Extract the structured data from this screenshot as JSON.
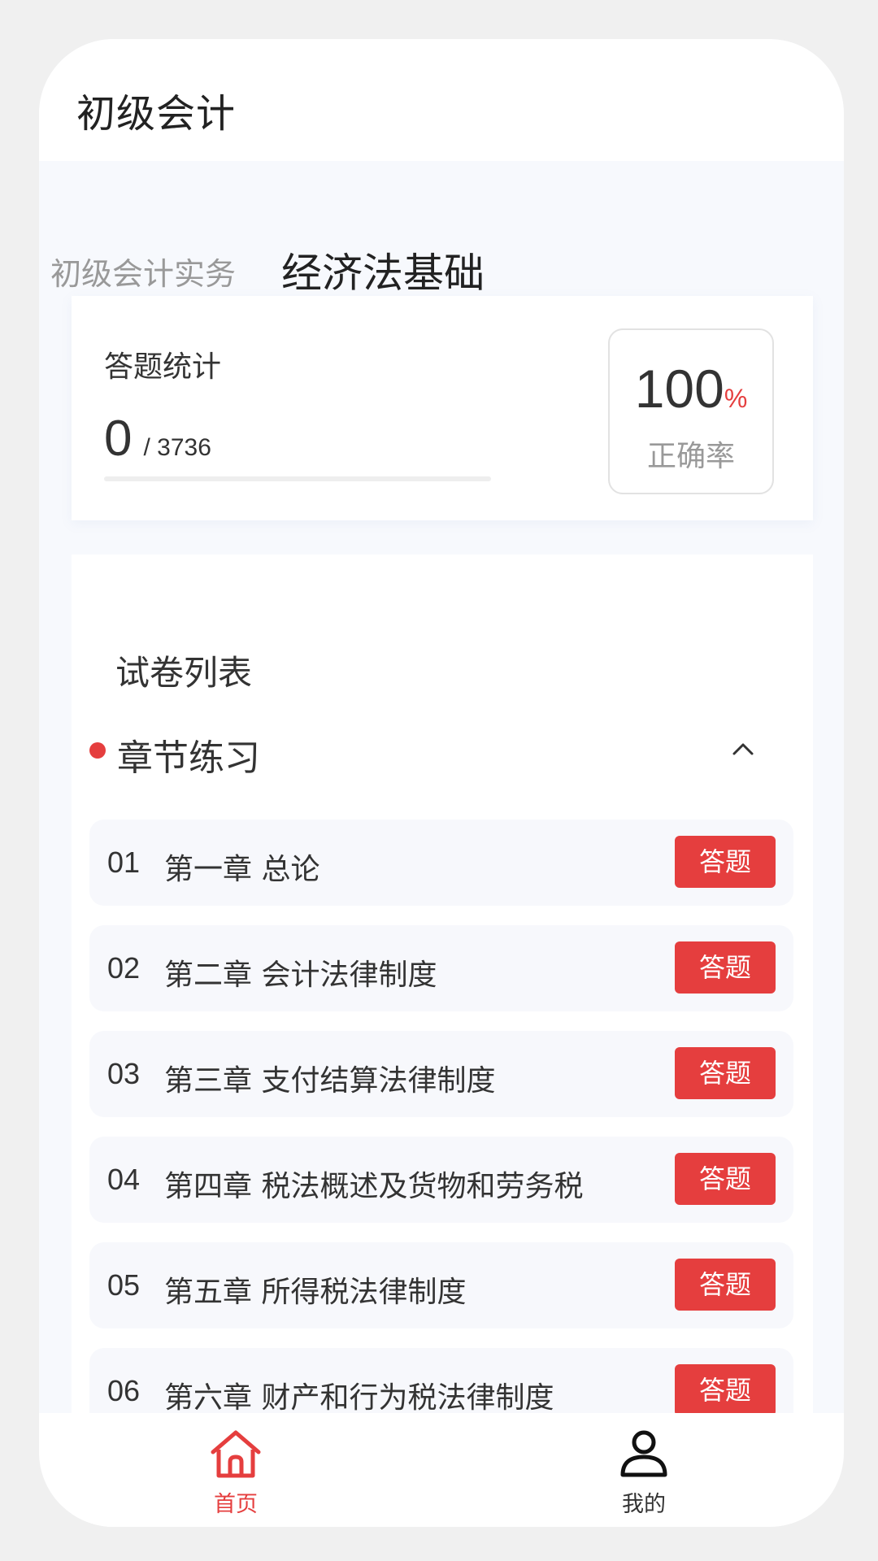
{
  "header": {
    "title": "初级会计"
  },
  "tabs": [
    {
      "label": "初级会计实务",
      "active": false
    },
    {
      "label": "经济法基础",
      "active": true
    }
  ],
  "stats": {
    "title": "答题统计",
    "answered": "0",
    "total": "/ 3736",
    "progress_fraction": 0,
    "accuracy_value": "100",
    "accuracy_unit": "%",
    "accuracy_label": "正确率"
  },
  "paper_list": {
    "title": "试卷列表",
    "section": {
      "label": "章节练习",
      "expanded": true,
      "toggle_icon": "chevron-up-icon"
    },
    "chapters": [
      {
        "num": "01",
        "name": "第一章 总论",
        "button": "答题"
      },
      {
        "num": "02",
        "name": "第二章 会计法律制度",
        "button": "答题"
      },
      {
        "num": "03",
        "name": "第三章 支付结算法律制度",
        "button": "答题"
      },
      {
        "num": "04",
        "name": "第四章 税法概述及货物和劳务税",
        "button": "答题"
      },
      {
        "num": "05",
        "name": "第五章 所得税法律制度",
        "button": "答题"
      },
      {
        "num": "06",
        "name": "第六章 财产和行为税法律制度",
        "button": "答题"
      }
    ]
  },
  "bottom_nav": [
    {
      "label": "首页",
      "icon": "home-icon",
      "active": true
    },
    {
      "label": "我的",
      "icon": "user-icon",
      "active": false
    }
  ],
  "colors": {
    "accent": "#e53e3e",
    "page_bg": "#f7f9fd",
    "card_bg": "#ffffff",
    "chapter_bg": "#f7f8fc"
  }
}
